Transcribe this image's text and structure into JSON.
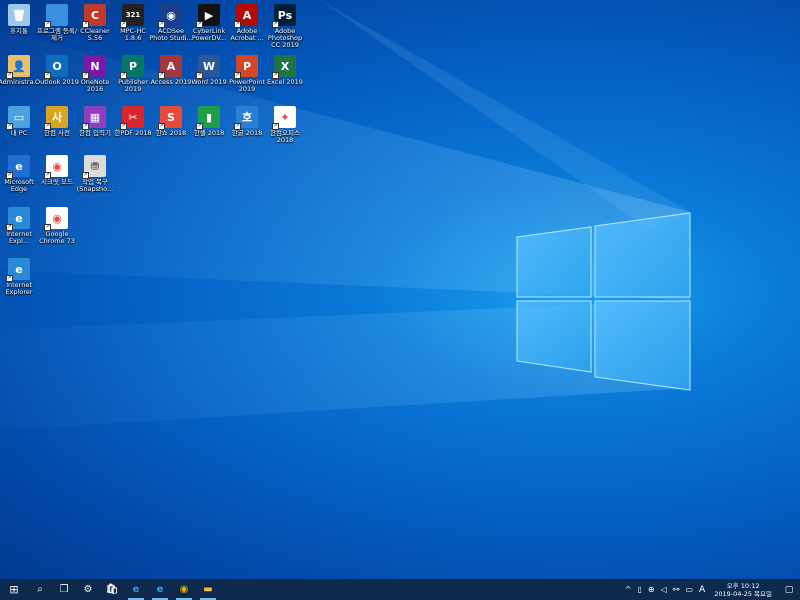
{
  "desktop": {
    "icons": [
      {
        "label": "휴지통",
        "icon": "recycle-bin-icon",
        "bg": "#9fc8e8",
        "glyph": "🗑"
      },
      {
        "label": "프로그램 등록/제거",
        "icon": "folder-icon",
        "bg": "#3b8fe0",
        "glyph": ""
      },
      {
        "label": "CCleaner 5.56",
        "icon": "ccleaner-icon",
        "bg": "#c0392b",
        "glyph": "C"
      },
      {
        "label": "MPC-HC 1.8.6",
        "icon": "mpc-hc-icon",
        "bg": "#222222",
        "glyph": "321"
      },
      {
        "label": "ACDSee Photo Studi...",
        "icon": "acdsee-icon",
        "bg": "#1b3f8a",
        "glyph": "◉"
      },
      {
        "label": "CyberLink PowerDV...",
        "icon": "powerdvd-icon",
        "bg": "#111111",
        "glyph": "▶"
      },
      {
        "label": "Adobe Acrobat ...",
        "icon": "acrobat-icon",
        "bg": "#b30b00",
        "glyph": "A"
      },
      {
        "label": "Adobe Photoshop CC 2019",
        "icon": "photoshop-icon",
        "bg": "#001e36",
        "glyph": "Ps"
      },
      {
        "label": "Administra...",
        "icon": "user-folder-icon",
        "bg": "#e8c06a",
        "glyph": "👤"
      },
      {
        "label": "Outlook 2019",
        "icon": "outlook-icon",
        "bg": "#0f6cbd",
        "glyph": "O"
      },
      {
        "label": "OneNote 2016",
        "icon": "onenote-icon",
        "bg": "#7719aa",
        "glyph": "N"
      },
      {
        "label": "Publisher 2019",
        "icon": "publisher-icon",
        "bg": "#077568",
        "glyph": "P"
      },
      {
        "label": "Access 2019",
        "icon": "access-icon",
        "bg": "#a4373a",
        "glyph": "A"
      },
      {
        "label": "Word 2019",
        "icon": "word-icon",
        "bg": "#2b579a",
        "glyph": "W"
      },
      {
        "label": "PowerPoint 2019",
        "icon": "powerpoint-icon",
        "bg": "#d24726",
        "glyph": "P"
      },
      {
        "label": "Excel 2019",
        "icon": "excel-icon",
        "bg": "#217346",
        "glyph": "X"
      },
      {
        "label": "내 PC",
        "icon": "this-pc-icon",
        "bg": "#4aa3e0",
        "glyph": "▭"
      },
      {
        "label": "한컴 사전",
        "icon": "hancom-dictionary-icon",
        "bg": "#d9a520",
        "glyph": "사"
      },
      {
        "label": "한컴 입력기",
        "icon": "hancom-input-icon",
        "bg": "#8e3fbf",
        "glyph": "▦"
      },
      {
        "label": "한PDF 2018",
        "icon": "hanpdf-icon",
        "bg": "#d8262e",
        "glyph": "✂"
      },
      {
        "label": "한쇼 2018",
        "icon": "hanshow-icon",
        "bg": "#e64a3b",
        "glyph": "S"
      },
      {
        "label": "한셀 2018",
        "icon": "hancell-icon",
        "bg": "#1f9e4a",
        "glyph": "▮"
      },
      {
        "label": "한글 2018",
        "icon": "hangul-icon",
        "bg": "#2a7fd4",
        "glyph": "호"
      },
      {
        "label": "한컴오피스 2018",
        "icon": "hancom-office-icon",
        "bg": "#ffffff",
        "glyph": "✦"
      },
      {
        "label": "Microsoft Edge",
        "icon": "edge-icon",
        "bg": "#1e6fd0",
        "glyph": "e"
      },
      {
        "label": "시크릿 모드",
        "icon": "chrome-incognito-icon",
        "bg": "#ffffff",
        "glyph": "◉"
      },
      {
        "label": "작업 복구 (Snapsho...",
        "icon": "snapshot-icon",
        "bg": "#dcdcdc",
        "glyph": "⛃"
      },
      {
        "label": "Internet Expl...",
        "icon": "ie-icon",
        "bg": "#2a8ad8",
        "glyph": "e"
      },
      {
        "label": "Google Chrome 73",
        "icon": "chrome-icon",
        "bg": "#ffffff",
        "glyph": "◉"
      },
      {
        "label": "Internet Explorer",
        "icon": "ie-icon",
        "bg": "#2a8ad8",
        "glyph": "e"
      }
    ]
  },
  "taskbar": {
    "start": "⊞",
    "search": "⌕",
    "taskview": "❐",
    "apps": [
      {
        "name": "settings-icon",
        "glyph": "⚙",
        "color": "#ffffff"
      },
      {
        "name": "store-icon",
        "glyph": "🛍",
        "color": "#ffffff"
      },
      {
        "name": "edge-icon",
        "glyph": "e",
        "color": "#3a96dd"
      },
      {
        "name": "ie-icon",
        "glyph": "e",
        "color": "#3aa0e8"
      },
      {
        "name": "chrome-icon",
        "glyph": "◉",
        "color": "#e8b10a"
      },
      {
        "name": "file-explorer-icon",
        "glyph": "▬",
        "color": "#f0c23a"
      }
    ],
    "tray": {
      "chevron": "^",
      "battery": "▯",
      "network": "⊕",
      "volume": "◁",
      "usb": "⚯",
      "keyboard": "▭",
      "ime": "A"
    },
    "clock_time": "오후 10:12",
    "clock_date": "2019-04-25 목요일",
    "notification": "▢"
  }
}
